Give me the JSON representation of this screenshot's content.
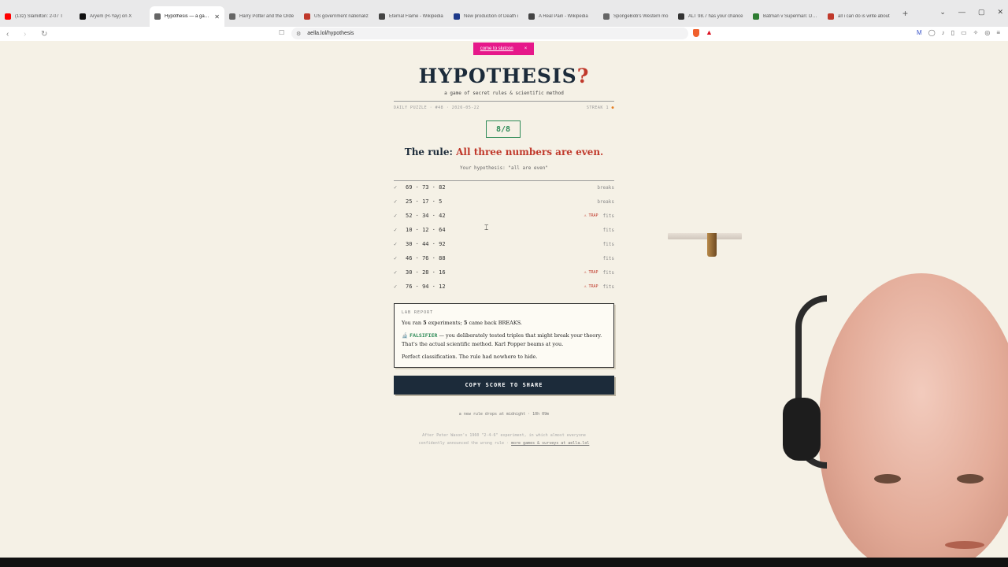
{
  "browser": {
    "tabs": [
      {
        "label": "(132) Slamilton: 2-07 T",
        "favicon": "youtube-icon",
        "color": "#ff0000",
        "active": false
      },
      {
        "label": "Aryem (R-Yay) on X",
        "favicon": "x-icon",
        "color": "#111111",
        "active": false
      },
      {
        "label": "Hypothesis — a game",
        "favicon": "globe-icon",
        "color": "#666666",
        "active": true
      },
      {
        "label": "Harry Potter and the Orde",
        "favicon": "globe-icon",
        "color": "#666666",
        "active": false
      },
      {
        "label": "US government nationaliz",
        "favicon": "news-icon",
        "color": "#c0392b",
        "active": false
      },
      {
        "label": "Eternal Flame - Wikipedia",
        "favicon": "wikipedia-icon",
        "color": "#444444",
        "active": false
      },
      {
        "label": "New production of Death i",
        "favicon": "news-icon",
        "color": "#1e3a8a",
        "active": false
      },
      {
        "label": "A Real Pain - Wikipedia",
        "favicon": "wikipedia-icon",
        "color": "#444444",
        "active": false
      },
      {
        "label": "SpongeBob's Western mo",
        "favicon": "news-icon",
        "color": "#666666",
        "active": false
      },
      {
        "label": "ALT 98.7 has your chance",
        "favicon": "radio-icon",
        "color": "#333333",
        "active": false
      },
      {
        "label": "Batman v Superman: Dawn",
        "favicon": "news-icon",
        "color": "#2e7d32",
        "active": false
      },
      {
        "label": "all i can do is write about",
        "favicon": "shield-icon",
        "color": "#c0392b",
        "active": false
      }
    ],
    "url": "aella.lol/hypothesis"
  },
  "banner": {
    "label": "come to slutcon",
    "close": "×"
  },
  "header": {
    "title": "HYPOTHESIS",
    "title_mark": "?",
    "subtitle": "a game of secret rules & scientific method"
  },
  "meta": {
    "left": "DAILY PUZZLE · #48 · 2026-05-22",
    "right": "STREAK 1"
  },
  "score": "8/8",
  "rule": {
    "prefix": "The rule:",
    "value": "All three numbers are even."
  },
  "hypothesis": "Your hypothesis: \"all are even\"",
  "experiments": [
    {
      "check": "✓",
      "triple": "69 · 73 · 82",
      "trap": "",
      "verdict": "breaks"
    },
    {
      "check": "✓",
      "triple": "25 · 17 · 5",
      "trap": "",
      "verdict": "breaks"
    },
    {
      "check": "✓",
      "triple": "52 · 34 · 42",
      "trap": "⚠ TRAP",
      "verdict": "fits"
    },
    {
      "check": "✓",
      "triple": "10 · 12 · 64",
      "trap": "",
      "verdict": "fits"
    },
    {
      "check": "✓",
      "triple": "30 · 44 · 92",
      "trap": "",
      "verdict": "fits"
    },
    {
      "check": "✓",
      "triple": "46 · 76 · 88",
      "trap": "",
      "verdict": "fits"
    },
    {
      "check": "✓",
      "triple": "30 · 28 · 16",
      "trap": "⚠ TRAP",
      "verdict": "fits"
    },
    {
      "check": "✓",
      "triple": "76 · 94 · 12",
      "trap": "⚠ TRAP",
      "verdict": "fits"
    }
  ],
  "lab_report": {
    "heading": "LAB REPORT",
    "line1_pre": "You ran ",
    "line1_n1": "5",
    "line1_mid": " experiments; ",
    "line1_n2": "5",
    "line1_post": " came back BREAKS.",
    "badge_icon": "🔬",
    "badge": "FALSIFIER",
    "line2": " — you deliberately tested triples that might break your theory. That's the actual scientific method. Karl Popper beams at you.",
    "line3": "Perfect classification. The rule had nowhere to hide."
  },
  "copy_button": "COPY SCORE TO SHARE",
  "next_rule": "a new rule drops at midnight · 10h 09m",
  "footer": {
    "text1": "After Peter Wason's 1960 \"2-4-6\" experiment, in which almost everyone",
    "text2": "confidently announced the wrong rule · ",
    "link": "more games & surveys at aella.lol"
  }
}
